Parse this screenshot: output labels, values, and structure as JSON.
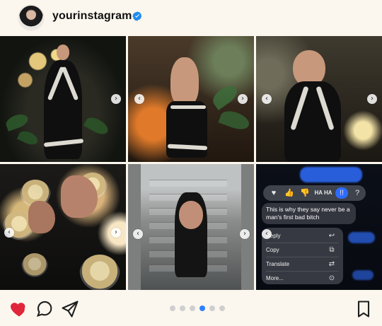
{
  "header": {
    "username": "yourinstagram",
    "verified": true,
    "avatar_icon": "avatar",
    "verified_icon": "verified-badge-icon",
    "verified_color": "#1d8cf0"
  },
  "grid": {
    "tiles": [
      {
        "name": "photo-1",
        "has_right_arrow": true,
        "has_left_arrow": false
      },
      {
        "name": "photo-2",
        "has_right_arrow": true,
        "has_left_arrow": true
      },
      {
        "name": "photo-3",
        "has_right_arrow": true,
        "has_left_arrow": true
      },
      {
        "name": "photo-4",
        "has_right_arrow": true,
        "has_left_arrow": true
      },
      {
        "name": "photo-5",
        "has_right_arrow": true,
        "has_left_arrow": true
      },
      {
        "name": "photo-6-dm-screenshot",
        "has_right_arrow": false,
        "has_left_arrow": true
      }
    ]
  },
  "dm_screenshot": {
    "reaction_labels": [
      "♥",
      "👍",
      "👎",
      "HA HA",
      "!!",
      "?"
    ],
    "message_text": "This is why they say never be a man's first bad bitch",
    "menu": {
      "reply_label": "Reply",
      "copy_label": "Copy",
      "translate_label": "Translate",
      "more_label": "More..."
    }
  },
  "bottom_bar": {
    "like_icon": "heart-icon",
    "like_color": "#e0263b",
    "comment_icon": "comment-icon",
    "share_icon": "share-icon",
    "save_icon": "bookmark-icon",
    "carousel": {
      "total_dots": 6,
      "active_index": 3,
      "active_color": "#2f80ff",
      "inactive_color": "#cfcfcf"
    }
  }
}
